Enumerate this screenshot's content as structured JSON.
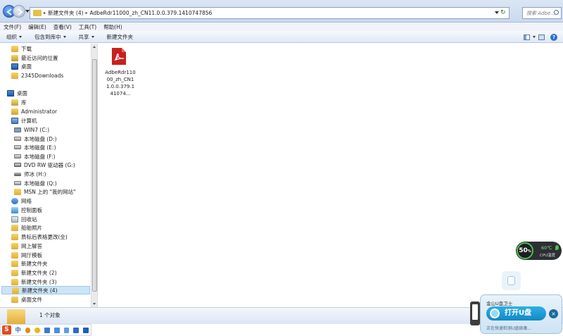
{
  "address": {
    "crumbs": [
      "新建文件夹 (4)",
      "AdbeRdr11000_zh_CN11.0.0.379.1410747856"
    ],
    "search_placeholder": "搜索 Adbe..."
  },
  "menu": [
    "文件(F)",
    "编辑(E)",
    "查看(V)",
    "工具(T)",
    "帮助(H)"
  ],
  "toolbar": {
    "items": [
      "组织",
      "包含到库中",
      "共享",
      "新建文件夹"
    ]
  },
  "nav": {
    "items": [
      {
        "label": "下载",
        "icon": "download"
      },
      {
        "label": "最近访问的位置",
        "icon": "recent"
      },
      {
        "label": "桌面",
        "icon": "desk"
      },
      {
        "label": "2345Downloads",
        "icon": "folder"
      },
      {
        "label": "桌面",
        "icon": "desk"
      },
      {
        "label": "库",
        "icon": "lib"
      },
      {
        "label": "Administrator",
        "icon": "user"
      },
      {
        "label": "计算机",
        "icon": "computer"
      },
      {
        "label": "WIN7 (C:)",
        "icon": "sysdrive"
      },
      {
        "label": "本地磁盘 (D:)",
        "icon": "drive"
      },
      {
        "label": "本地磁盘 (E:)",
        "icon": "drive"
      },
      {
        "label": "本地磁盘 (F:)",
        "icon": "drive"
      },
      {
        "label": "DVD RW 驱动器 (G:)",
        "icon": "dvd"
      },
      {
        "label": "师冰 (H:)",
        "icon": "usb"
      },
      {
        "label": "本地磁盘 (Q:)",
        "icon": "drive"
      },
      {
        "label": "MSN 上的 \"我的网站\"",
        "icon": "folder"
      },
      {
        "label": "网络",
        "icon": "network"
      },
      {
        "label": "控制面板",
        "icon": "panel"
      },
      {
        "label": "回收站",
        "icon": "trash"
      },
      {
        "label": "船舶照片",
        "icon": "folder"
      },
      {
        "label": "质标后表格更改(全)",
        "icon": "folder"
      },
      {
        "label": "网上解答",
        "icon": "folder"
      },
      {
        "label": "网厅模板",
        "icon": "folder"
      },
      {
        "label": "新建文件夹",
        "icon": "folder"
      },
      {
        "label": "新建文件夹 (2)",
        "icon": "folder"
      },
      {
        "label": "新建文件夹 (3)",
        "icon": "folder"
      },
      {
        "label": "新建文件夹 (4)",
        "icon": "folder",
        "selected": true
      },
      {
        "label": "桌面文件",
        "icon": "folder"
      }
    ]
  },
  "content": {
    "files": [
      {
        "name": "AdbeRdr11000_zh_CN11.0.0.379.141074...",
        "icon": "pdf-icon"
      }
    ]
  },
  "status": {
    "count_text": "1 个对象"
  },
  "ime": {
    "logo": "S",
    "mode": "中"
  },
  "cpu": {
    "usage": "50",
    "pct_sign": "%",
    "temp": "60℃",
    "label": "CPU温度"
  },
  "usb_guard": {
    "title": "金山U盘卫士",
    "button": "打开U盘",
    "subtitle": "正在快速检测U盘病毒...",
    "close": "×"
  },
  "colors": {
    "selection": "#cce4f7",
    "accent": "#1188c6"
  }
}
